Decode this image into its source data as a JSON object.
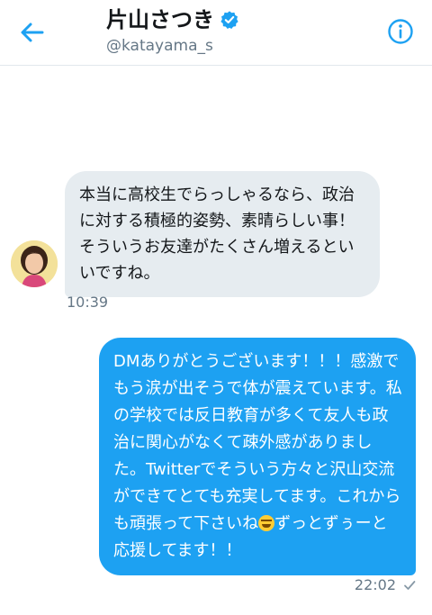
{
  "header": {
    "name": "片山さつき",
    "handle": "@katayama_s",
    "back_icon": "back-arrow-icon",
    "verified_icon": "verified-badge-icon",
    "info_icon": "info-icon"
  },
  "messages": [
    {
      "direction": "incoming",
      "text": "本当に高校生でらっしゃるなら、政治に対する積極的姿勢、素晴らしい事！そういうお友達がたくさん増えるといいですね。",
      "time": "10:39"
    },
    {
      "direction": "outgoing",
      "text_before_emoji": "DMありがとうございます！！！感激でもう涙が出そうで体が震えています。私の学校では反日教育が多くて友人も政治に関心がなくて疎外感がありました。Twitterでそういう方々と沢山交流ができてとても充実してます。これからも頑張って下さいね",
      "emoji": "grinning-squinting-face",
      "text_after_emoji": "ずっとずぅーと応援してます！！",
      "time": "22:02",
      "status_icon": "check-icon"
    }
  ],
  "colors": {
    "accent": "#1da1f2",
    "incoming_bubble": "#e6ecf0",
    "text": "#14171a",
    "secondary_text": "#657786"
  }
}
